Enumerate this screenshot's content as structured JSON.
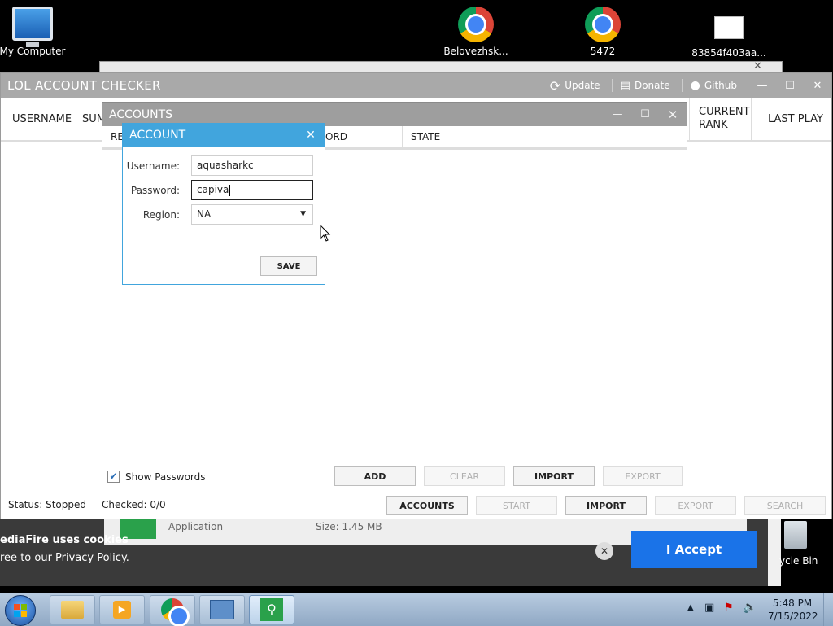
{
  "desktop": {
    "icons": [
      {
        "label": "My Computer",
        "icon": "computer-icon"
      },
      {
        "label": "Belovezhsk...",
        "icon": "chrome-icon"
      },
      {
        "label": "5472",
        "icon": "chrome-icon"
      },
      {
        "label": "83854f403aa...",
        "icon": "document-icon"
      },
      {
        "label": "ycle Bin",
        "icon": "recycle-bin-icon"
      }
    ]
  },
  "main_window": {
    "title": "LOL ACCOUNT CHECKER",
    "actions": {
      "update": "Update",
      "donate": "Donate",
      "github": "Github"
    },
    "columns": {
      "username": "USERNAME",
      "summoner": "SUM",
      "current_rank": "CURRENT RANK",
      "last_play": "LAST PLAY"
    },
    "status": {
      "status": "Status: Stopped",
      "checked": "Checked: 0/0"
    },
    "buttons": {
      "accounts": "ACCOUNTS",
      "start": "START",
      "import": "IMPORT",
      "export": "EXPORT",
      "search": "SEARCH"
    }
  },
  "accounts_window": {
    "title": "ACCOUNTS",
    "columns": {
      "region": "RE",
      "password": "ORD",
      "state": "STATE"
    },
    "show_passwords_label": "Show Passwords",
    "show_passwords_checked": true,
    "buttons": {
      "add": "ADD",
      "clear": "CLEAR",
      "import": "IMPORT",
      "export": "EXPORT"
    }
  },
  "account_dialog": {
    "title": "ACCOUNT",
    "username_label": "Username:",
    "username_value": "aquasharkc",
    "password_label": "Password:",
    "password_value": "capiva",
    "region_label": "Region:",
    "region_value": "NA",
    "save_label": "SAVE"
  },
  "background_page": {
    "app_type": "Application",
    "size": "Size: 1.45 MB",
    "cookie_line1": "ediaFire uses cookies",
    "cookie_line2": "ree to our Privacy Policy.",
    "accept_label": "I Accept"
  },
  "taskbar": {
    "time": "5:48 PM",
    "date": "7/15/2022"
  },
  "colors": {
    "dialog_accent": "#41a5dd",
    "titlebar_gray": "#a9a9a9",
    "accept_blue": "#1a73e8"
  }
}
